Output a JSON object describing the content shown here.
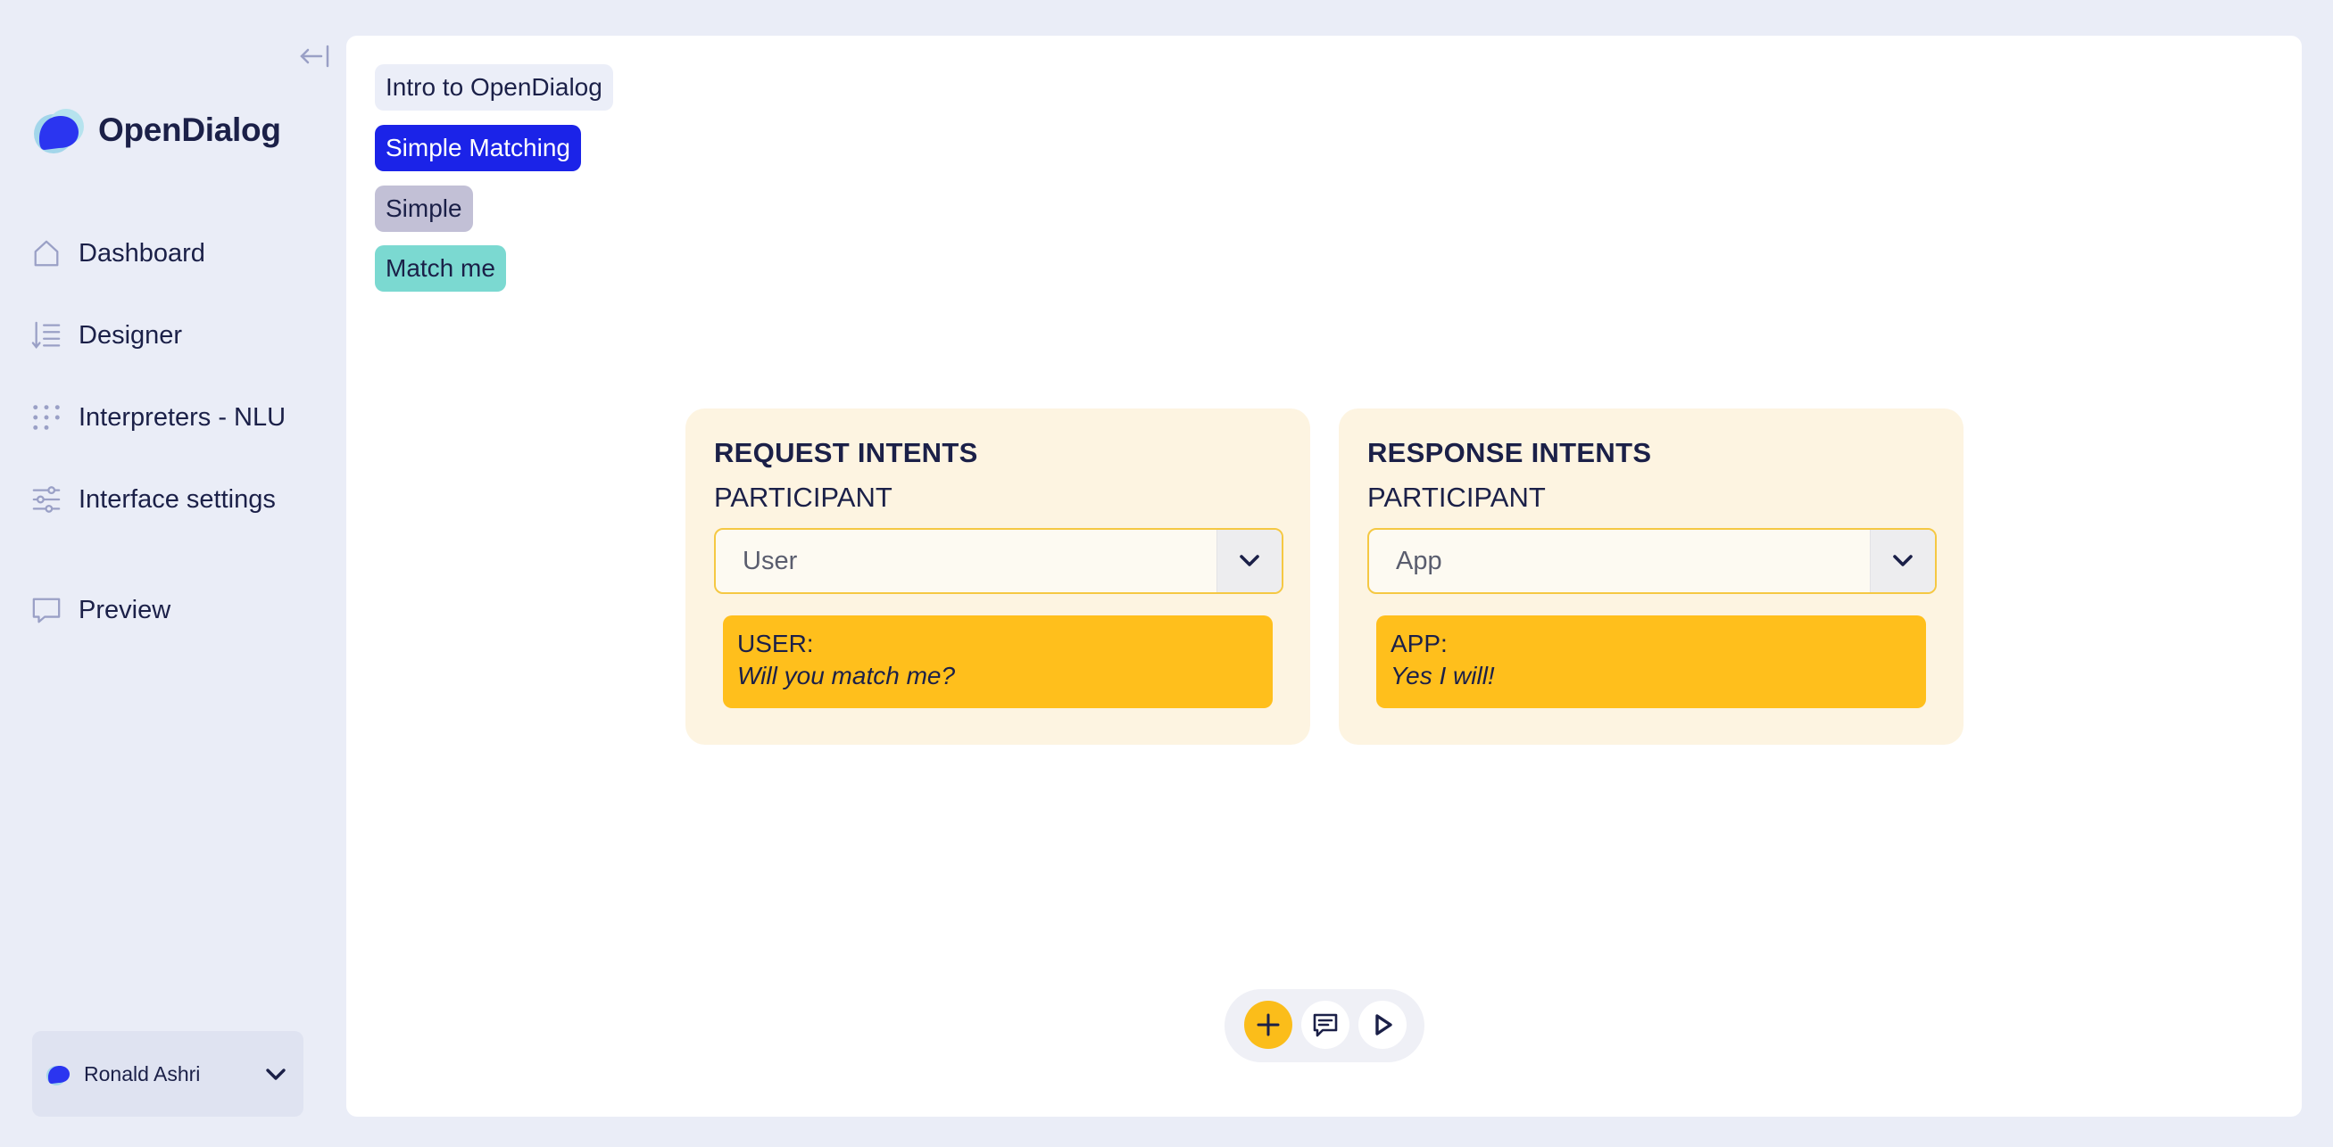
{
  "app": {
    "name": "OpenDialog"
  },
  "sidebar": {
    "items": [
      {
        "label": "Dashboard",
        "icon": "home-icon"
      },
      {
        "label": "Designer",
        "icon": "designer-icon"
      },
      {
        "label": "Interpreters - NLU",
        "icon": "dots-grid-icon"
      },
      {
        "label": "Interface settings",
        "icon": "sliders-icon"
      },
      {
        "label": "Preview",
        "icon": "monitor-icon"
      }
    ],
    "user": {
      "name": "Ronald Ashri"
    }
  },
  "breadcrumb": {
    "scenario": "Intro to OpenDialog",
    "conversation": "Simple Matching",
    "scene": "Simple",
    "turn": "Match me"
  },
  "request": {
    "title": "REQUEST INTENTS",
    "participant_label": "PARTICIPANT",
    "participant_value": "User",
    "speaker": "USER:",
    "intent": "Will you match me?"
  },
  "response": {
    "title": "RESPONSE INTENTS",
    "participant_label": "PARTICIPANT",
    "participant_value": "App",
    "speaker": "APP:",
    "intent": "Yes I will!"
  },
  "colors": {
    "background": "#eaedf7",
    "brand_blue": "#1b23e8",
    "accent_yellow": "#ffbf1c",
    "card_bg": "#fdf4e1",
    "turn_teal": "#7bd9d1",
    "scene_grey": "#c2c0d6",
    "text_navy": "#1b2048"
  },
  "toolbar": {
    "icons": [
      "plus-icon",
      "chat-icon",
      "play-icon"
    ]
  }
}
